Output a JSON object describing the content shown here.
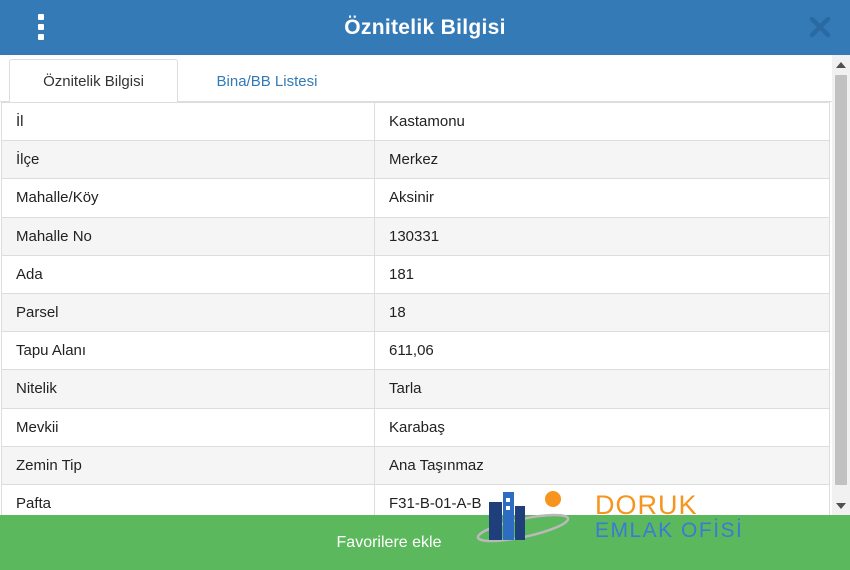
{
  "header": {
    "title": "Öznitelik Bilgisi",
    "menu_icon": "vertical-dots-icon",
    "close_icon": "close-icon",
    "color": "#337ab7"
  },
  "tabs": [
    {
      "label": "Öznitelik Bilgisi",
      "active": true
    },
    {
      "label": "Bina/BB Listesi",
      "active": false
    }
  ],
  "attributes": [
    {
      "key": "İl",
      "value": "Kastamonu"
    },
    {
      "key": "İlçe",
      "value": "Merkez"
    },
    {
      "key": "Mahalle/Köy",
      "value": "Aksinir"
    },
    {
      "key": "Mahalle No",
      "value": "130331"
    },
    {
      "key": "Ada",
      "value": "181"
    },
    {
      "key": "Parsel",
      "value": "18"
    },
    {
      "key": "Tapu Alanı",
      "value": "611,06"
    },
    {
      "key": "Nitelik",
      "value": "Tarla"
    },
    {
      "key": "Mevkii",
      "value": "Karabaş"
    },
    {
      "key": "Zemin Tip",
      "value": "Ana Taşınmaz"
    },
    {
      "key": "Pafta",
      "value": "F31-B-01-A-B"
    }
  ],
  "footer": {
    "button_label": "Favorilere ekle",
    "color": "#5cb85c"
  },
  "watermark": {
    "line1": "DORUK",
    "line2": "EMLAK OFİSİ",
    "orange": "#f7941d",
    "blue": "#3a7bd5"
  }
}
